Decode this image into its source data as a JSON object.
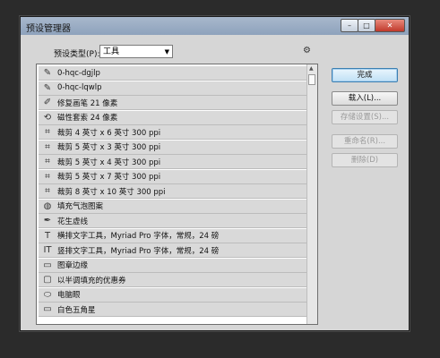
{
  "window": {
    "title": "预设管理器",
    "min_label": "–",
    "max_label": "□",
    "close_label": "✕"
  },
  "preset_type": {
    "label": "预设类型(P):",
    "value": "工具"
  },
  "list": {
    "items": [
      {
        "icon": "brush-icon",
        "glyph": "✎",
        "label": "0-hqc-dgjlp"
      },
      {
        "icon": "brush-icon",
        "glyph": "✎",
        "label": "0-hqc-lqwlp"
      },
      {
        "icon": "healing-brush-icon",
        "glyph": "✐",
        "label": "修复画笔 21 像素"
      },
      {
        "icon": "magnetic-lasso-icon",
        "glyph": "⟲",
        "label": "磁性套索 24 像素"
      },
      {
        "icon": "crop-icon",
        "glyph": "⌗",
        "label": "裁剪 4 英寸 x 6 英寸 300 ppi"
      },
      {
        "icon": "crop-icon",
        "glyph": "⌗",
        "label": "裁剪 5 英寸 x 3 英寸 300 ppi"
      },
      {
        "icon": "crop-icon",
        "glyph": "⌗",
        "label": "裁剪 5 英寸 x 4 英寸 300 ppi"
      },
      {
        "icon": "crop-icon",
        "glyph": "⌗",
        "label": "裁剪 5 英寸 x 7 英寸 300 ppi"
      },
      {
        "icon": "crop-icon",
        "glyph": "⌗",
        "label": "裁剪 8 英寸 x 10 英寸 300 ppi"
      },
      {
        "icon": "paint-bucket-icon",
        "glyph": "◍",
        "label": "填充气泡图案"
      },
      {
        "icon": "pen-icon",
        "glyph": "✒",
        "label": "花生虚线"
      },
      {
        "icon": "type-icon",
        "glyph": "T",
        "label": "横排文字工具，Myriad Pro 字体，常规，24 磅"
      },
      {
        "icon": "vertical-type-icon",
        "glyph": "IT",
        "label": "竖排文字工具，Myriad Pro 字体，常规，24 磅"
      },
      {
        "icon": "rectangle-icon",
        "glyph": "▭",
        "label": "图章边缘"
      },
      {
        "icon": "rounded-rectangle-icon",
        "glyph": "▢",
        "label": "以半调填充的优惠券"
      },
      {
        "icon": "ellipse-icon",
        "glyph": "⬭",
        "label": "电脑眼"
      },
      {
        "icon": "rectangle-icon",
        "glyph": "▭",
        "label": "白色五角星"
      }
    ]
  },
  "buttons": {
    "done": "完成",
    "load": "载入(L)...",
    "save": "存储设置(S)...",
    "rename": "重命名(R)...",
    "delete": "删除(D)"
  }
}
